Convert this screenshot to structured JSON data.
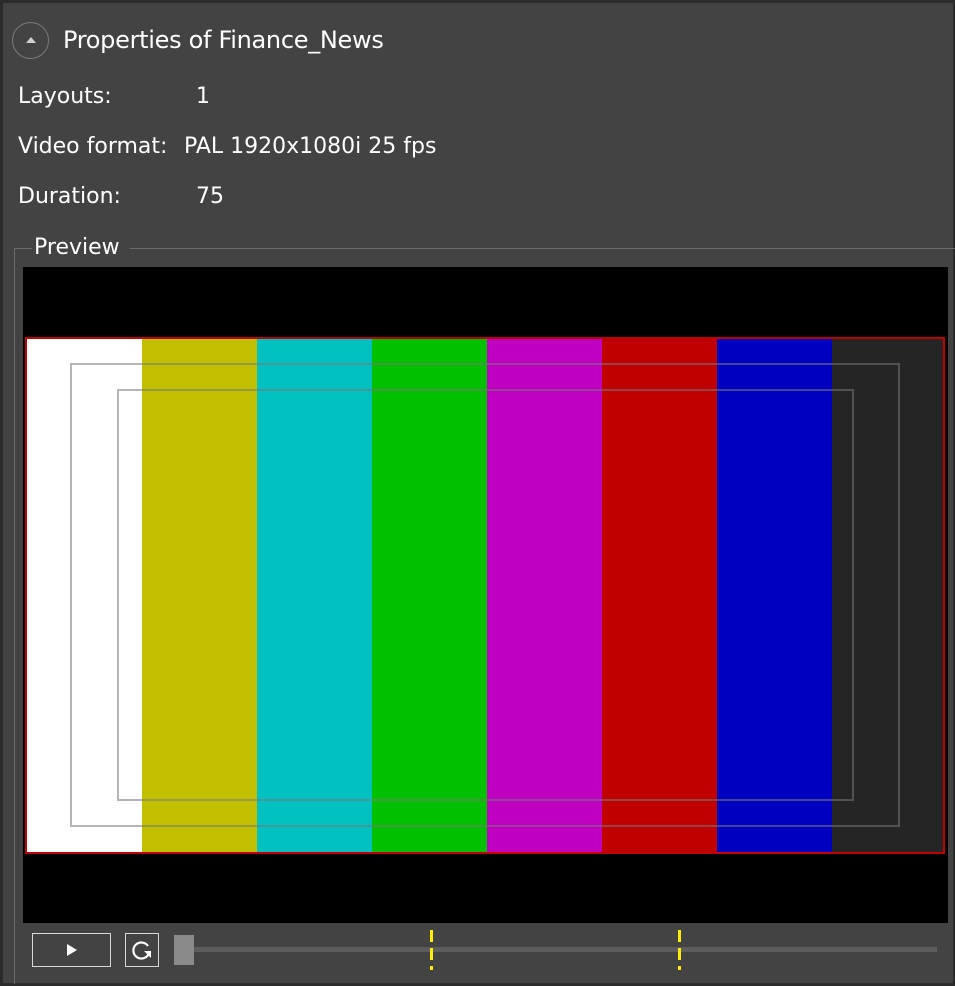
{
  "header": {
    "title": "Properties of Finance_News",
    "collapse_icon": "chevron-up-icon"
  },
  "properties": [
    {
      "label": "Layouts:",
      "value": "1"
    },
    {
      "label": "Video format:",
      "value": "PAL 1920x1080i 25 fps"
    },
    {
      "label": "Duration:",
      "value": "75"
    }
  ],
  "preview": {
    "legend": "Preview",
    "color_bars": [
      "#ffffff",
      "#c0c000",
      "#00c0c0",
      "#00c000",
      "#c000c0",
      "#c00000",
      "#0000c0",
      "#252525"
    ],
    "frame_border_color": "#c00000",
    "background_color": "#000000"
  },
  "playback": {
    "play_icon": "play-icon",
    "loop_icon": "loop-icon",
    "position_fraction": 0.0,
    "marker_fractions": [
      0.335,
      0.66
    ],
    "marker_color": "#ffee00"
  }
}
